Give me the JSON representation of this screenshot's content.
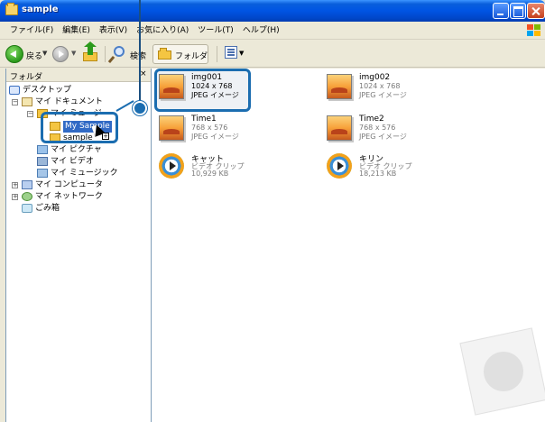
{
  "window": {
    "title": "sample",
    "colors": {
      "titlebar": "#0054e3",
      "callout": "#1b6db0",
      "selection": "#316ac5"
    }
  },
  "menubar": {
    "items": [
      "ファイル(F)",
      "編集(E)",
      "表示(V)",
      "お気に入り(A)",
      "ツール(T)",
      "ヘルプ(H)"
    ]
  },
  "toolbar": {
    "back_label": "戻る",
    "search_label": "検索",
    "folders_label": "フォルダ"
  },
  "folder_pane": {
    "header": "フォルダ",
    "close_glyph": "×",
    "tree": [
      {
        "label": "デスクトップ",
        "icon": "desktop-icon"
      },
      {
        "label": "マイ ドキュメント",
        "icon": "my-documents-icon"
      },
      {
        "label": "マイ ミュージ",
        "icon": "folder-icon"
      },
      {
        "label": "My Sample",
        "icon": "folder-icon",
        "selected": true
      },
      {
        "label": "sample",
        "icon": "folder-icon"
      },
      {
        "label": "マイ ピクチャ",
        "icon": "pictures-icon"
      },
      {
        "label": "マイ ビデオ",
        "icon": "video-icon"
      },
      {
        "label": "マイ ミュージック",
        "icon": "music-icon"
      },
      {
        "label": "マイ コンピュータ",
        "icon": "computer-icon"
      },
      {
        "label": "マイ ネットワーク",
        "icon": "network-icon"
      },
      {
        "label": "ごみ箱",
        "icon": "recycle-bin-icon"
      }
    ]
  },
  "files": [
    {
      "name": "img001",
      "line1": "1024 x 768",
      "line2": "JPEG イメージ",
      "type": "jpeg",
      "highlighted": true
    },
    {
      "name": "img002",
      "line1": "1024 x 768",
      "line2": "JPEG イメージ",
      "type": "jpeg"
    },
    {
      "name": "Time1",
      "line1": "768 x 576",
      "line2": "JPEG イメージ",
      "type": "jpeg"
    },
    {
      "name": "Time2",
      "line1": "768 x 576",
      "line2": "JPEG イメージ",
      "type": "jpeg"
    },
    {
      "name": "キャット",
      "line1": "ビデオ クリップ",
      "line2": "10,929 KB",
      "type": "video"
    },
    {
      "name": "キリン",
      "line1": "ビデオ クリップ",
      "line2": "18,213 KB",
      "type": "video"
    }
  ]
}
